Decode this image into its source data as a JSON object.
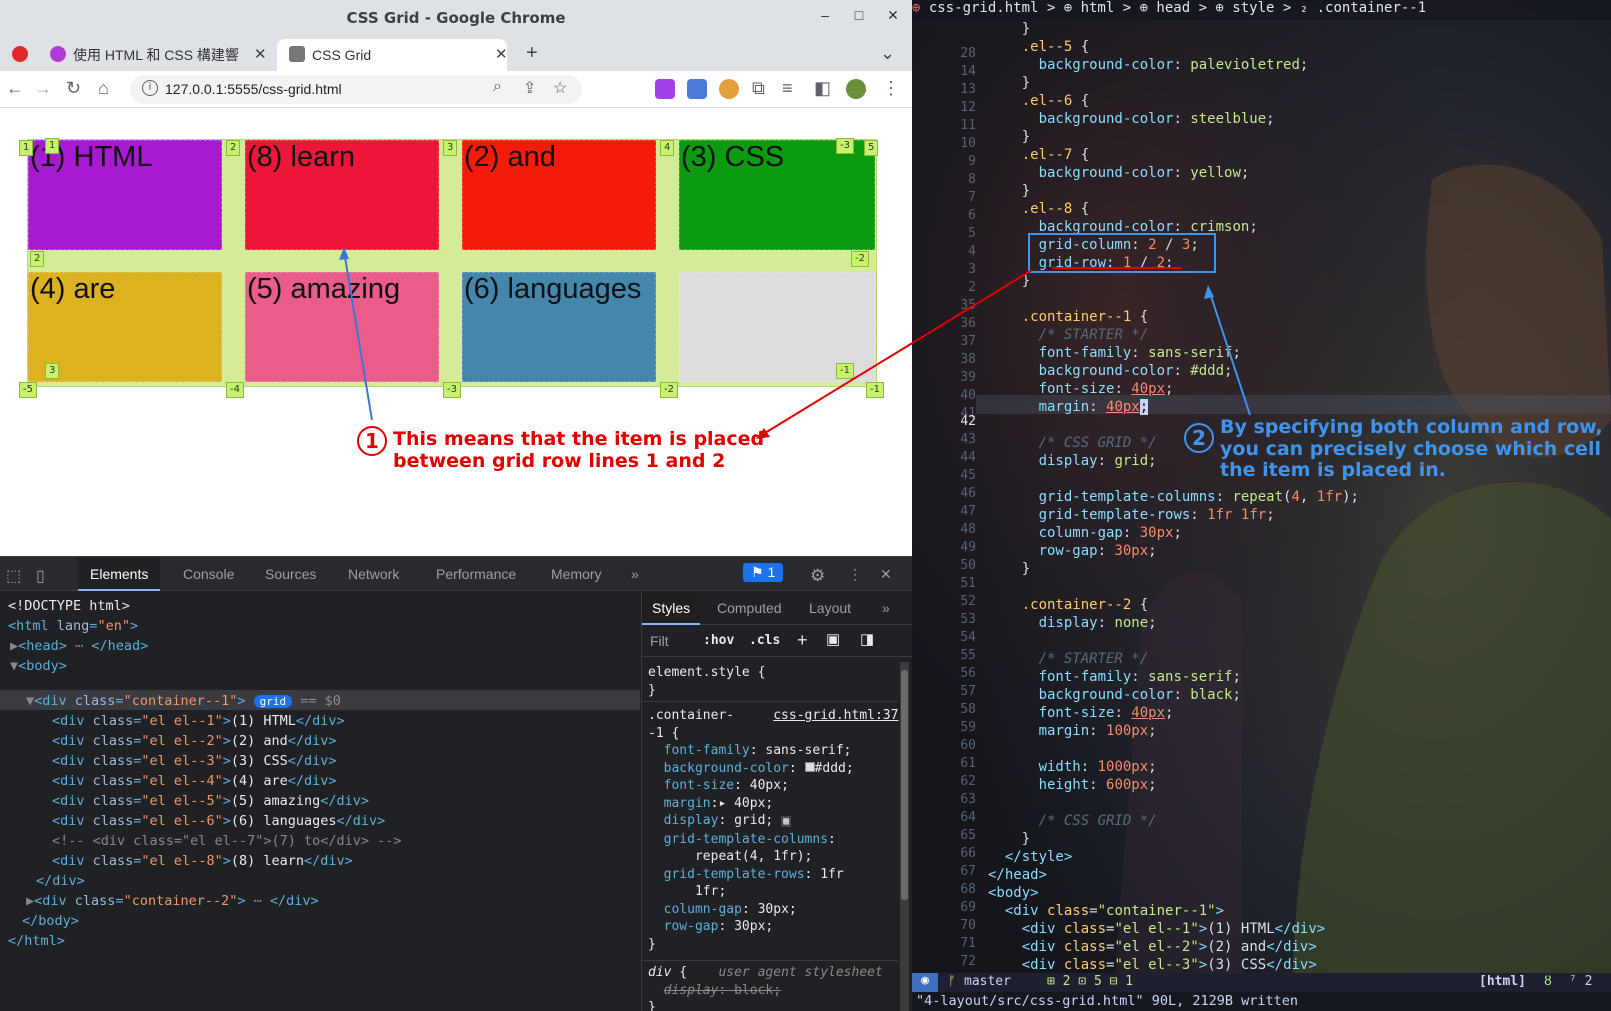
{
  "window": {
    "title": "CSS Grid - Google Chrome",
    "minimize": "–",
    "maximize": "□",
    "close": "✕"
  },
  "tabs": [
    {
      "label": "使用 HTML 和 CSS 構建響"
    },
    {
      "label": "CSS Grid"
    }
  ],
  "new_tab": "+",
  "tab_search": "⌄",
  "address": {
    "url": "127.0.0.1:5555/css-grid.html"
  },
  "grid": {
    "cells": [
      {
        "label": "(1) HTML",
        "color": "#a81ad1"
      },
      {
        "label": "(8) learn",
        "color": "#ee1638"
      },
      {
        "label": "(2) and",
        "color": "#f51a0a"
      },
      {
        "label": "(3) CSS",
        "color": "#0c9a10"
      },
      {
        "label": "(4) are",
        "color": "#dcb220"
      },
      {
        "label": "(5) amazing",
        "color": "#ea5d8b"
      },
      {
        "label": "(6) languages",
        "color": "#4586ab"
      },
      {
        "label": "",
        "color": "#dddddd"
      }
    ],
    "line_labels": {
      "c1": "1",
      "c2": "2",
      "c3": "3",
      "c4": "4",
      "c5": "5",
      "r1": "1",
      "r2": "2",
      "r3": "3",
      "nc5": "-5",
      "nc4": "-4",
      "nc3": "-3",
      "nc2": "-2",
      "nc1": "-1",
      "nr1": "-1",
      "nr2": "-2",
      "nr3": "-3"
    }
  },
  "annotation1": {
    "num": "1",
    "line1": "This means that the item is placed",
    "line2": "between grid row lines 1 and 2"
  },
  "devtools": {
    "tabs": [
      "Elements",
      "Console",
      "Sources",
      "Network",
      "Performance",
      "Memory"
    ],
    "more": "»",
    "issues": "1",
    "dom": {
      "l1": "<!DOCTYPE html>",
      "grid_badge": "grid",
      "dollar": "== $0"
    },
    "styles_tabs": [
      "Styles",
      "Computed",
      "Layout"
    ],
    "filter": "Filt",
    "hov": ":hov",
    "cls": ".cls",
    "element_style": "element.style {",
    "source": "css-grid.html:37",
    "ua": "user agent stylesheet"
  },
  "annotation2": {
    "num": "2",
    "line1": "By specifying both column and row,",
    "line2": "you can precisely choose which cell",
    "line3": "the item is placed in."
  },
  "editor": {
    "breadcrumb": "css-grid.html > ⊕ html > ⊕ head > ⊕ style > ₂ .container--1",
    "branch": "master",
    "status_counts": "⊞ 2 ⊡ 5 ⊟ 1",
    "filetype": "[html]",
    "pos": "⁷ 2",
    "cmdline": "\"4-layout/src/css-grid.html\" 90L, 2129B written"
  }
}
